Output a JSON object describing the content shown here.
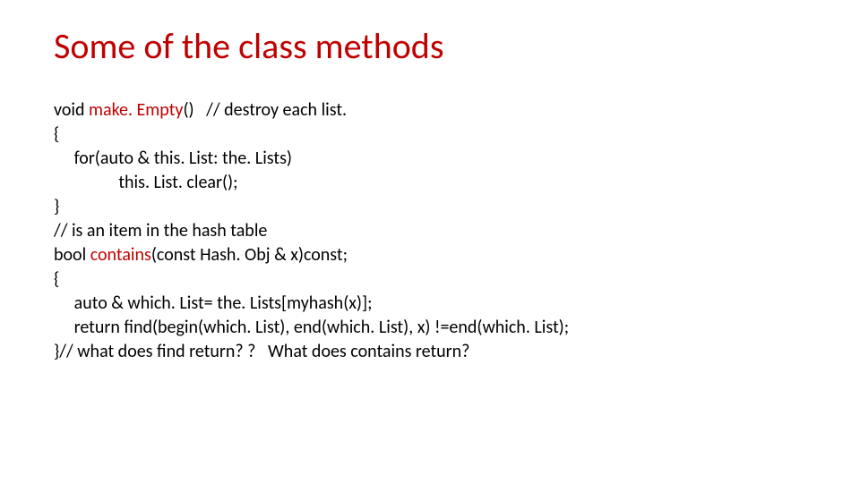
{
  "title": "Some of the class methods",
  "code": {
    "l1a": "void ",
    "l1fn": "make. Empty",
    "l1b": "()   // destroy each list.",
    "l2": "{",
    "l3": "     for(auto & this. List: the. Lists)",
    "l4": "                this. List. clear();",
    "l5": "}",
    "l6": "// is an item in the hash table",
    "l7a": "bool ",
    "l7fn": "contains",
    "l7b": "(const Hash. Obj & x)const;",
    "l8": "{",
    "l9": "     auto & which. List= the. Lists[myhash(x)];",
    "l10": "     return find(begin(which. List), end(which. List), x) !=end(which. List);",
    "l11": "}// what does find return? ?   What does contains return?"
  }
}
